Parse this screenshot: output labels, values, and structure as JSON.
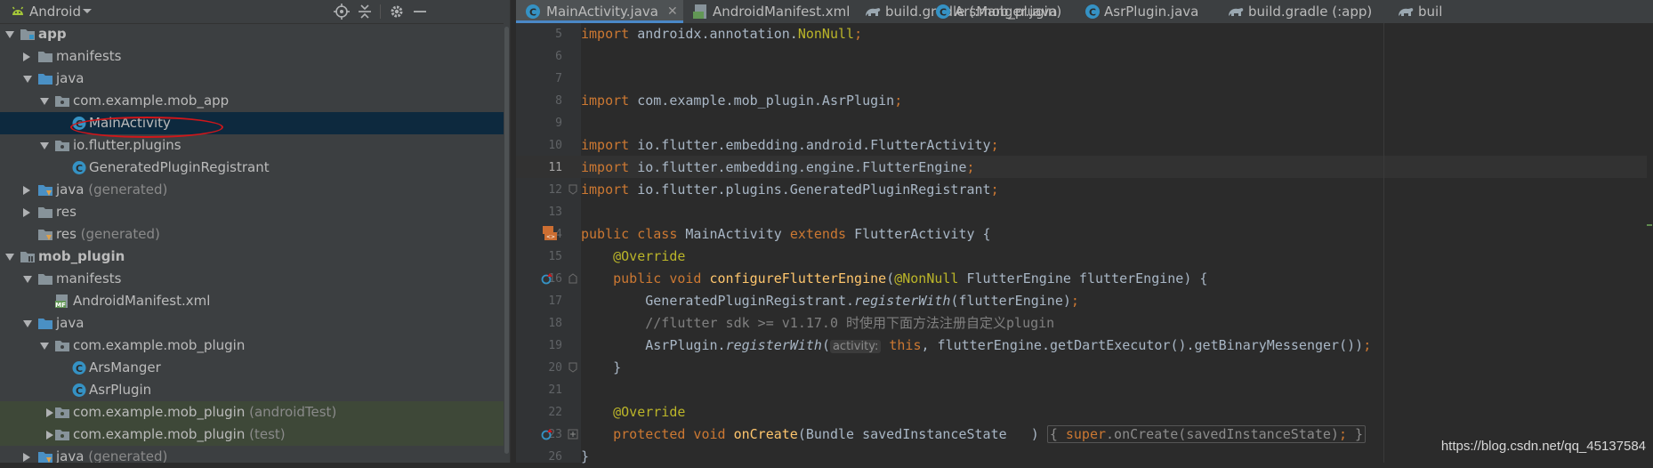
{
  "project_panel": {
    "view_label": "Android",
    "rows": [
      {
        "label": "app",
        "suffix": "",
        "bold": true
      },
      {
        "label": "manifests",
        "suffix": ""
      },
      {
        "label": "java",
        "suffix": ""
      },
      {
        "label": "com.example.mob_app",
        "suffix": ""
      },
      {
        "label": "MainActivity",
        "suffix": ""
      },
      {
        "label": "io.flutter.plugins",
        "suffix": ""
      },
      {
        "label": "GeneratedPluginRegistrant",
        "suffix": ""
      },
      {
        "label": "java",
        "suffix": "(generated)"
      },
      {
        "label": "res",
        "suffix": ""
      },
      {
        "label": "res",
        "suffix": "(generated)"
      },
      {
        "label": "mob_plugin",
        "suffix": "",
        "bold": true
      },
      {
        "label": "manifests",
        "suffix": ""
      },
      {
        "label": "AndroidManifest.xml",
        "suffix": ""
      },
      {
        "label": "java",
        "suffix": ""
      },
      {
        "label": "com.example.mob_plugin",
        "suffix": ""
      },
      {
        "label": "ArsManger",
        "suffix": ""
      },
      {
        "label": "AsrPlugin",
        "suffix": ""
      },
      {
        "label": "com.example.mob_plugin",
        "suffix": "(androidTest)"
      },
      {
        "label": "com.example.mob_plugin",
        "suffix": "(test)"
      },
      {
        "label": "java",
        "suffix": "(generated)"
      }
    ]
  },
  "tabs": [
    {
      "label": "MainActivity.java",
      "icon": "class-icon",
      "active": true,
      "close": "✕"
    },
    {
      "label": "AndroidManifest.xml",
      "icon": "manifest-icon",
      "active": false
    },
    {
      "label": "build.gradle (:mob_plugin)",
      "icon": "gradle-icon",
      "active": false
    },
    {
      "label": "ArsManger.java",
      "icon": "class-icon",
      "active": false
    },
    {
      "label": "AsrPlugin.java",
      "icon": "class-icon",
      "active": false
    },
    {
      "label": "build.gradle (:app)",
      "icon": "gradle-icon",
      "active": false
    },
    {
      "label": "buil",
      "icon": "gradle-icon",
      "active": false
    }
  ],
  "editor": {
    "line_numbers": [
      "5",
      "6",
      "7",
      "8",
      "9",
      "10",
      "11",
      "12",
      "13",
      "14",
      "15",
      "16",
      "17",
      "18",
      "19",
      "20",
      "21",
      "22",
      "23",
      "26"
    ],
    "current_line": "11",
    "code": {
      "l5_kw": "import",
      "l5_rest": " androidx.annotation.",
      "l5_ann": "NonNull",
      "l5_semi": ";",
      "l8_kw": "import",
      "l8_rest": " com.example.mob_plugin.AsrPlugin",
      "l8_semi": ";",
      "l10_kw": "import",
      "l10_rest": " io.flutter.embedding.android.FlutterActivity",
      "l10_semi": ";",
      "l11_kw": "import",
      "l11_rest": " io.flutter.embedding.engine.FlutterEngine",
      "l11_semi": ";",
      "l12_kw": "import",
      "l12_rest": " io.flutter.plugins.GeneratedPluginRegistrant",
      "l12_semi": ";",
      "l14_kw1": "public class ",
      "l14_name": "MainActivity ",
      "l14_kw2": "extends ",
      "l14_rest": "FlutterActivity {",
      "l15_ann": "@Override",
      "l16_kw": "public void ",
      "l16_fn": "configureFlutterEngine",
      "l16_p1": "(",
      "l16_ann": "@NonNull ",
      "l16_rest": "FlutterEngine flutterEngine) {",
      "l17_a": "GeneratedPluginRegistrant.",
      "l17_it": "registerWith",
      "l17_b": "(flutterEngine)",
      "l17_semi": ";",
      "l18_cm": "//flutter sdk >= v1.17.0 时使用下面方法注册自定义plugin",
      "l19_a": "AsrPlugin.",
      "l19_it": "registerWith",
      "l19_b": "(",
      "l19_hint": "activity:",
      "l19_kw": " this",
      "l19_c": ", flutterEngine.getDartExecutor().getBinaryMessenger())",
      "l19_semi": ";",
      "l20": "}",
      "l22_ann": "@Override",
      "l23_kw": "protected void ",
      "l23_fn": "onCreate",
      "l23_rest": "(Bundle savedInstanceState",
      "l23_fold1": ")",
      "l23_open": "{",
      "l23_kw2": " super",
      "l23_call": ".onCreate(savedInstanceState)",
      "l23_semi": ";",
      "l23_close": "}",
      "l26": "}"
    }
  },
  "watermark": "https://blog.csdn.net/qq_45137584",
  "colors": {
    "keyword": "#cc7832",
    "annotation": "#bbb529",
    "method": "#ffc66d",
    "comment": "#808080",
    "selection": "#0d293e",
    "annotation_circle": "#d0161a"
  }
}
